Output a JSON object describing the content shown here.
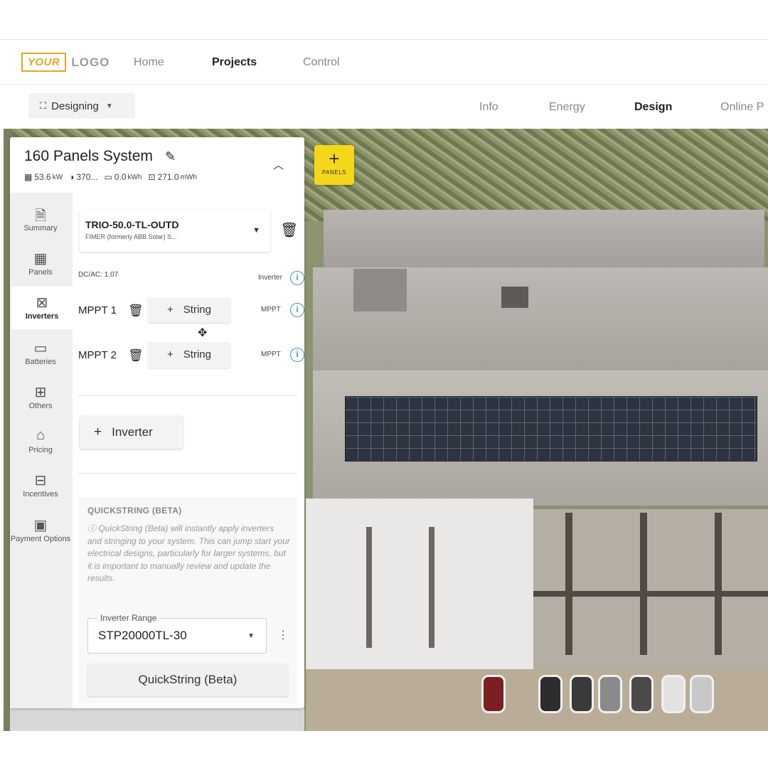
{
  "logo": {
    "your": "YOUR",
    "text": "LOGO"
  },
  "nav": {
    "home": "Home",
    "projects": "Projects",
    "control": "Control"
  },
  "subbar": {
    "dropdown_label": "Designing",
    "tabs": {
      "info": "Info",
      "energy": "Energy",
      "design": "Design",
      "online": "Online P"
    }
  },
  "map": {
    "panels_button_label": "PANELS"
  },
  "system": {
    "title": "160 Panels System",
    "stats": {
      "power": "53.6",
      "power_unit": "kW",
      "ratio": "370...",
      "battery": "0.0",
      "battery_unit": "kWh",
      "energy": "271.0",
      "energy_unit": "mWh"
    }
  },
  "sidenav": {
    "items": [
      {
        "label": "Summary",
        "icon": "document-icon"
      },
      {
        "label": "Panels",
        "icon": "grid-icon"
      },
      {
        "label": "Inverters",
        "icon": "inverter-icon"
      },
      {
        "label": "Batteries",
        "icon": "battery-icon"
      },
      {
        "label": "Others",
        "icon": "apps-icon"
      },
      {
        "label": "Pricing",
        "icon": "tag-icon"
      },
      {
        "label": "Incentives",
        "icon": "gift-icon"
      },
      {
        "label": "Payment Options",
        "icon": "wallet-icon"
      }
    ]
  },
  "inverter": {
    "model": "TRIO-50.0-TL-OUTD",
    "manufacturer": "FIMER (formerly ABB Solar) S...",
    "dc_ac": "DC/AC: 1.07",
    "info_label": "Inverter",
    "mppts": [
      {
        "label": "MPPT 1",
        "string_label": "String",
        "info_label": "MPPT"
      },
      {
        "label": "MPPT 2",
        "string_label": "String",
        "info_label": "MPPT"
      }
    ],
    "add_inverter_label": "Inverter"
  },
  "quickstring": {
    "title": "QUICKSTRING (BETA)",
    "description": "QuickString (Beta) will instantly apply inverters and stringing to your system. This can jump start your electrical designs, particularly for larger systems, but it is important to manually review and update the results.",
    "range_legend": "Inverter Range",
    "range_value": "STP20000TL-30",
    "button_label": "QuickString (Beta)"
  },
  "colors": {
    "accent_yellow": "#f4d71b",
    "logo_orange": "#e9a325",
    "info_blue": "#3b8fd8"
  }
}
